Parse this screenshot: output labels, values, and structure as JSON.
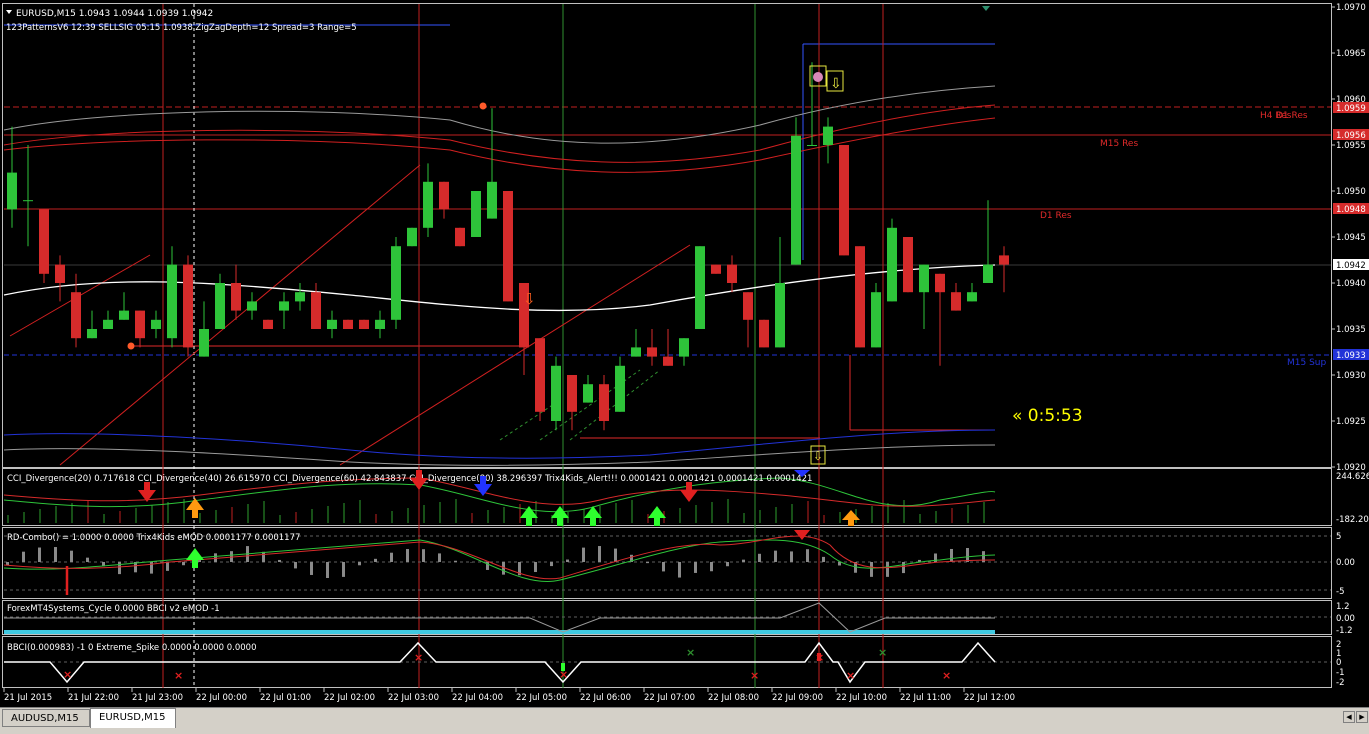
{
  "main_chart": {
    "header": "EURUSD,M15  1.0943 1.0944 1.0939 1.0942",
    "indicator_line": "123PatternsV6  12:39  SELLSIG  05:15  1.0938  ZigZagDepth=12  Spread=3  Range=5",
    "countdown": "« 0:5:53",
    "price_ticks": [
      "1.0970",
      "1.0965",
      "1.0960",
      "1.0955",
      "1.0950",
      "1.0945",
      "1.0940",
      "1.0935",
      "1.0930",
      "1.0925",
      "1.0920"
    ],
    "current_price": "1.0942",
    "level_tags": [
      "1.0959",
      "1.0956",
      "1.0948",
      "1.0933"
    ],
    "level_labels": [
      "H4 Res",
      "D1 Res",
      "M15 Res",
      "D1 Res",
      "M15 Sup"
    ],
    "candles": [
      {
        "o": 1.0948,
        "h": 1.0957,
        "l": 1.0946,
        "c": 1.0952
      },
      {
        "o": 1.0949,
        "h": 1.0955,
        "l": 1.0944,
        "c": 1.0949
      },
      {
        "o": 1.0948,
        "h": 1.0948,
        "l": 1.094,
        "c": 1.0941
      },
      {
        "o": 1.0942,
        "h": 1.0943,
        "l": 1.0938,
        "c": 1.094
      },
      {
        "o": 1.0939,
        "h": 1.0941,
        "l": 1.0933,
        "c": 1.0934
      },
      {
        "o": 1.0934,
        "h": 1.0937,
        "l": 1.0934,
        "c": 1.0935
      },
      {
        "o": 1.0935,
        "h": 1.0937,
        "l": 1.0935,
        "c": 1.0936
      },
      {
        "o": 1.0936,
        "h": 1.0939,
        "l": 1.0936,
        "c": 1.0937
      },
      {
        "o": 1.0937,
        "h": 1.0937,
        "l": 1.0933,
        "c": 1.0934
      },
      {
        "o": 1.0935,
        "h": 1.0937,
        "l": 1.0934,
        "c": 1.0936
      },
      {
        "o": 1.0934,
        "h": 1.0944,
        "l": 1.0933,
        "c": 1.0942
      },
      {
        "o": 1.0942,
        "h": 1.0943,
        "l": 1.0932,
        "c": 1.0933
      },
      {
        "o": 1.0932,
        "h": 1.0938,
        "l": 1.0932,
        "c": 1.0935
      },
      {
        "o": 1.0935,
        "h": 1.0941,
        "l": 1.0935,
        "c": 1.094
      },
      {
        "o": 1.094,
        "h": 1.0942,
        "l": 1.0936,
        "c": 1.0937
      },
      {
        "o": 1.0937,
        "h": 1.0939,
        "l": 1.0936,
        "c": 1.0938
      },
      {
        "o": 1.0936,
        "h": 1.0936,
        "l": 1.0935,
        "c": 1.0935
      },
      {
        "o": 1.0937,
        "h": 1.0939,
        "l": 1.0935,
        "c": 1.0938
      },
      {
        "o": 1.0938,
        "h": 1.094,
        "l": 1.0937,
        "c": 1.0939
      },
      {
        "o": 1.0939,
        "h": 1.094,
        "l": 1.0935,
        "c": 1.0935
      },
      {
        "o": 1.0935,
        "h": 1.0937,
        "l": 1.0934,
        "c": 1.0936
      },
      {
        "o": 1.0936,
        "h": 1.0936,
        "l": 1.0935,
        "c": 1.0935
      },
      {
        "o": 1.0936,
        "h": 1.0936,
        "l": 1.0935,
        "c": 1.0935
      },
      {
        "o": 1.0935,
        "h": 1.0937,
        "l": 1.0934,
        "c": 1.0936
      },
      {
        "o": 1.0936,
        "h": 1.0945,
        "l": 1.0935,
        "c": 1.0944
      },
      {
        "o": 1.0944,
        "h": 1.0946,
        "l": 1.0944,
        "c": 1.0946
      },
      {
        "o": 1.0946,
        "h": 1.0953,
        "l": 1.0945,
        "c": 1.0951
      },
      {
        "o": 1.0951,
        "h": 1.0951,
        "l": 1.0947,
        "c": 1.0948
      },
      {
        "o": 1.0946,
        "h": 1.0946,
        "l": 1.0944,
        "c": 1.0944
      },
      {
        "o": 1.0945,
        "h": 1.095,
        "l": 1.0945,
        "c": 1.095
      },
      {
        "o": 1.0947,
        "h": 1.0959,
        "l": 1.0947,
        "c": 1.0951
      },
      {
        "o": 1.095,
        "h": 1.095,
        "l": 1.0938,
        "c": 1.0938
      },
      {
        "o": 1.094,
        "h": 1.094,
        "l": 1.093,
        "c": 1.0933
      },
      {
        "o": 1.0934,
        "h": 1.0934,
        "l": 1.0925,
        "c": 1.0926
      },
      {
        "o": 1.0925,
        "h": 1.0932,
        "l": 1.0924,
        "c": 1.0931
      },
      {
        "o": 1.093,
        "h": 1.093,
        "l": 1.0924,
        "c": 1.0926
      },
      {
        "o": 1.0927,
        "h": 1.093,
        "l": 1.0927,
        "c": 1.0929
      },
      {
        "o": 1.0929,
        "h": 1.093,
        "l": 1.0924,
        "c": 1.0925
      },
      {
        "o": 1.0926,
        "h": 1.0932,
        "l": 1.0926,
        "c": 1.0931
      },
      {
        "o": 1.0932,
        "h": 1.0935,
        "l": 1.0932,
        "c": 1.0933
      },
      {
        "o": 1.0933,
        "h": 1.0935,
        "l": 1.0931,
        "c": 1.0932
      },
      {
        "o": 1.0932,
        "h": 1.0935,
        "l": 1.0931,
        "c": 1.0931
      },
      {
        "o": 1.0932,
        "h": 1.0934,
        "l": 1.0931,
        "c": 1.0934
      },
      {
        "o": 1.0935,
        "h": 1.0944,
        "l": 1.0935,
        "c": 1.0944
      },
      {
        "o": 1.0942,
        "h": 1.0942,
        "l": 1.0941,
        "c": 1.0941
      },
      {
        "o": 1.0942,
        "h": 1.0943,
        "l": 1.0939,
        "c": 1.094
      },
      {
        "o": 1.0939,
        "h": 1.0939,
        "l": 1.0933,
        "c": 1.0936
      },
      {
        "o": 1.0936,
        "h": 1.0936,
        "l": 1.0933,
        "c": 1.0933
      },
      {
        "o": 1.0933,
        "h": 1.0945,
        "l": 1.0933,
        "c": 1.094
      },
      {
        "o": 1.0942,
        "h": 1.0958,
        "l": 1.0942,
        "c": 1.0956
      },
      {
        "o": 1.0955,
        "h": 1.0964,
        "l": 1.0955,
        "c": 1.0955
      },
      {
        "o": 1.0955,
        "h": 1.0958,
        "l": 1.0953,
        "c": 1.0957
      },
      {
        "o": 1.0955,
        "h": 1.0955,
        "l": 1.0943,
        "c": 1.0943
      },
      {
        "o": 1.0944,
        "h": 1.0944,
        "l": 1.0933,
        "c": 1.0933
      },
      {
        "o": 1.0933,
        "h": 1.094,
        "l": 1.0933,
        "c": 1.0939
      },
      {
        "o": 1.0938,
        "h": 1.0947,
        "l": 1.0938,
        "c": 1.0946
      },
      {
        "o": 1.0945,
        "h": 1.0945,
        "l": 1.0939,
        "c": 1.0939
      },
      {
        "o": 1.0939,
        "h": 1.0942,
        "l": 1.0935,
        "c": 1.0942
      },
      {
        "o": 1.0941,
        "h": 1.0941,
        "l": 1.0931,
        "c": 1.0939
      },
      {
        "o": 1.0939,
        "h": 1.094,
        "l": 1.0937,
        "c": 1.0937
      },
      {
        "o": 1.0938,
        "h": 1.094,
        "l": 1.0938,
        "c": 1.0939
      },
      {
        "o": 1.094,
        "h": 1.0949,
        "l": 1.094,
        "c": 1.0942
      },
      {
        "o": 1.0943,
        "h": 1.0944,
        "l": 1.0939,
        "c": 1.0942
      }
    ]
  },
  "sub_panels": {
    "cci": {
      "text": "CCI_Divergence(20) 0.717618  CCI_Divergence(40) 26.615970  CCI_Divergence(60) 42.843837  CCI_Divergence(80) 38.296397  Trix4Kids_Alert!!! 0.0001421 0.0001421 0.0001421 0.0001421",
      "scale": [
        "244.626",
        "-182.206"
      ]
    },
    "rd": {
      "text": "RD-Combo() = 1.0000 0.0000  Trix4Kids eMOD 0.0001177 0.0001177",
      "scale": [
        "5",
        "0.00",
        "-5"
      ]
    },
    "forex": {
      "text": "ForexMT4Systems_Cycle 0.0000  BBCI v2 eMOD -1",
      "scale": [
        "1.2",
        "0.00",
        "-1.2"
      ]
    },
    "bbci": {
      "text": "BBCI(0.000983) -1 0  Extreme_Spike 0.0000 0.0000 0.0000",
      "scale": [
        "2",
        "1",
        "0",
        "-1",
        "-2"
      ]
    }
  },
  "time_axis": [
    "21 Jul 2015",
    "21 Jul 22:00",
    "21 Jul 23:00",
    "22 Jul 00:00",
    "22 Jul 01:00",
    "22 Jul 02:00",
    "22 Jul 03:00",
    "22 Jul 04:00",
    "22 Jul 05:00",
    "22 Jul 06:00",
    "22 Jul 07:00",
    "22 Jul 08:00",
    "22 Jul 09:00",
    "22 Jul 10:00",
    "22 Jul 11:00",
    "22 Jul 12:00"
  ],
  "tabs": [
    {
      "label": "AUDUSD,M15"
    },
    {
      "label": "EURUSD,M15"
    }
  ],
  "colors": {
    "bull": "#2ec43a",
    "bear": "#d62b2b",
    "res": "#e02a2a",
    "sup": "#2233d8"
  }
}
